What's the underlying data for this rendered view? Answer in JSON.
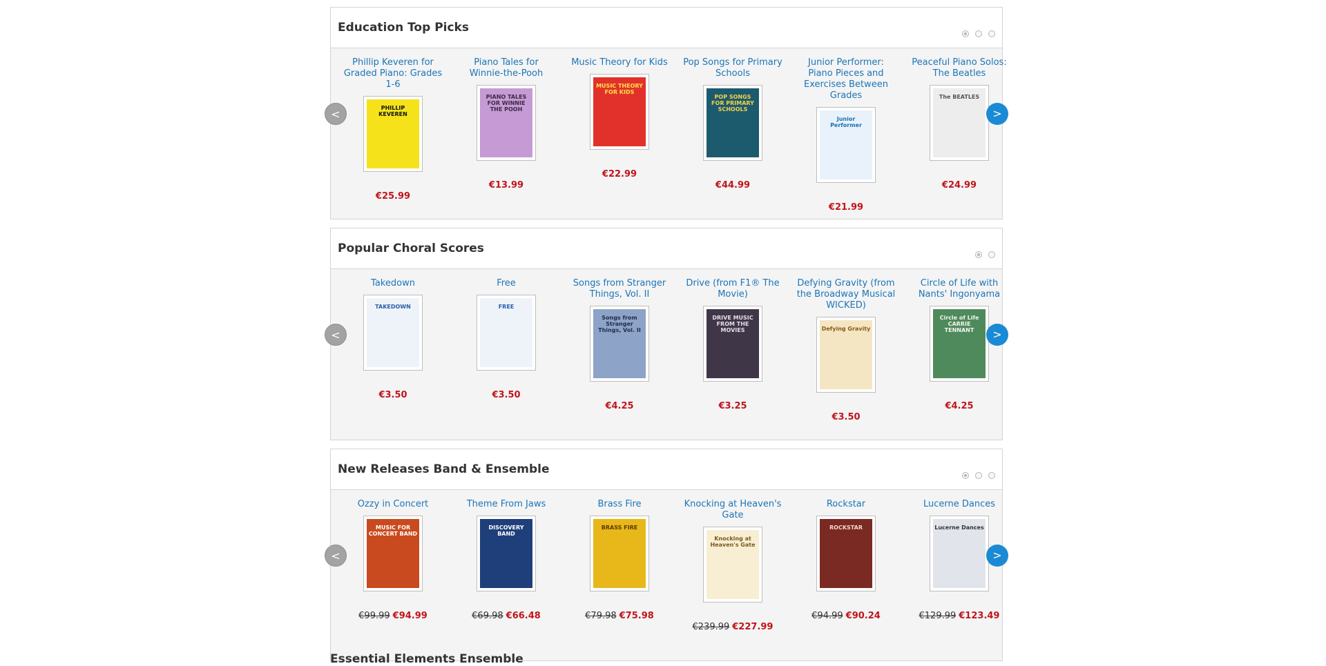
{
  "sections": [
    {
      "title": "Education Top Picks",
      "dots": 3,
      "items": [
        {
          "title": "Phillip Keveren for Graded Piano: Grades 1-6",
          "price": "€25.99",
          "old_price": "",
          "cover_text": "PHILLIP KEVEREN",
          "cover_bg": "#f5e21a",
          "cover_fg": "#111111"
        },
        {
          "title": "Piano Tales for Winnie-the-Pooh",
          "price": "€13.99",
          "old_price": "",
          "cover_text": "PIANO TALES FOR WINNIE THE POOH",
          "cover_bg": "#c69ad4",
          "cover_fg": "#3a2a44"
        },
        {
          "title": "Music Theory for Kids",
          "price": "€22.99",
          "old_price": "",
          "cover_text": "MUSIC THEORY FOR KIDS",
          "cover_bg": "#e2312a",
          "cover_fg": "#ffe14a"
        },
        {
          "title": "Pop Songs for Primary Schools",
          "price": "€44.99",
          "old_price": "",
          "cover_text": "POP SONGS FOR PRIMARY SCHOOLS",
          "cover_bg": "#1c5a6e",
          "cover_fg": "#f3d24a"
        },
        {
          "title": "Junior Performer: Piano Pieces and Exercises Between Grades",
          "price": "€21.99",
          "old_price": "",
          "cover_text": "Junior Performer",
          "cover_bg": "#e9f2fb",
          "cover_fg": "#1a6fb3"
        },
        {
          "title": "Peaceful Piano Solos: The Beatles",
          "price": "€24.99",
          "old_price": "",
          "cover_text": "The BEATLES",
          "cover_bg": "#ededed",
          "cover_fg": "#555555"
        }
      ]
    },
    {
      "title": "Popular Choral Scores",
      "dots": 2,
      "items": [
        {
          "title": "Takedown",
          "price": "€3.50",
          "old_price": "",
          "cover_text": "TAKEDOWN",
          "cover_bg": "#eef3fa",
          "cover_fg": "#2a5fa8"
        },
        {
          "title": "Free",
          "price": "€3.50",
          "old_price": "",
          "cover_text": "FREE",
          "cover_bg": "#eef3fa",
          "cover_fg": "#2a5fa8"
        },
        {
          "title": "Songs from Stranger Things, Vol. II",
          "price": "€4.25",
          "old_price": "",
          "cover_text": "Songs from Stranger Things, Vol. II",
          "cover_bg": "#8da3c7",
          "cover_fg": "#1d2e4a"
        },
        {
          "title": "Drive (from F1® The Movie)",
          "price": "€3.25",
          "old_price": "",
          "cover_text": "DRIVE MUSIC FROM THE MOVIES",
          "cover_bg": "#3f3748",
          "cover_fg": "#e6dbe8"
        },
        {
          "title": "Defying Gravity (from the Broadway Musical WICKED)",
          "price": "€3.50",
          "old_price": "",
          "cover_text": "Defying Gravity",
          "cover_bg": "#f4e6c2",
          "cover_fg": "#8a5a12"
        },
        {
          "title": "Circle of Life with Nants' Ingonyama",
          "price": "€4.25",
          "old_price": "",
          "cover_text": "Circle of Life CARRIE TENNANT",
          "cover_bg": "#4f8a5c",
          "cover_fg": "#f0f7ec"
        }
      ]
    },
    {
      "title": "New Releases Band & Ensemble",
      "dots": 3,
      "items": [
        {
          "title": "Ozzy in Concert",
          "price": "€94.99",
          "old_price": "€99.99",
          "cover_text": "MUSIC FOR CONCERT BAND",
          "cover_bg": "#c94a1e",
          "cover_fg": "#ffffff"
        },
        {
          "title": "Theme From Jaws",
          "price": "€66.48",
          "old_price": "€69.98",
          "cover_text": "DISCOVERY BAND",
          "cover_bg": "#1f3f7a",
          "cover_fg": "#ffffff"
        },
        {
          "title": "Brass Fire",
          "price": "€75.98",
          "old_price": "€79.98",
          "cover_text": "BRASS FIRE",
          "cover_bg": "#e8b81a",
          "cover_fg": "#5a3a00"
        },
        {
          "title": "Knocking at Heaven's Gate",
          "price": "€227.99",
          "old_price": "€239.99",
          "cover_text": "Knocking at Heaven's Gate",
          "cover_bg": "#f7eed3",
          "cover_fg": "#7a5a1a"
        },
        {
          "title": "Rockstar",
          "price": "€90.24",
          "old_price": "€94.99",
          "cover_text": "ROCKSTAR",
          "cover_bg": "#7a2a22",
          "cover_fg": "#f5d6c9"
        },
        {
          "title": "Lucerne Dances",
          "price": "€123.49",
          "old_price": "€129.99",
          "cover_text": "Lucerne Dances",
          "cover_bg": "#e1e4ea",
          "cover_fg": "#333333"
        }
      ]
    }
  ],
  "icons": {
    "prev": "chevron-left-icon",
    "next": "chevron-right-icon"
  },
  "arrows": {
    "prev": "<",
    "next": ">"
  },
  "next_section_title": "Essential Elements Ensemble"
}
